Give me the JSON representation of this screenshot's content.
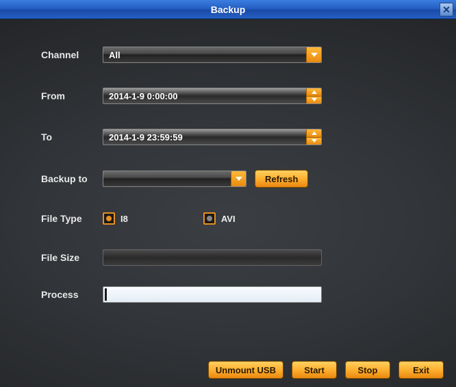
{
  "title": "Backup",
  "labels": {
    "channel": "Channel",
    "from": "From",
    "to": "To",
    "backup_to": "Backup to",
    "file_type": "File Type",
    "file_size": "File Size",
    "process": "Process"
  },
  "fields": {
    "channel_value": "All",
    "from_value": "2014-1-9 0:00:00",
    "to_value": "2014-1-9 23:59:59",
    "backup_to_value": "",
    "file_size_value": ""
  },
  "file_type": {
    "opt1": "I8",
    "opt2": "AVI",
    "selected": "I8"
  },
  "buttons": {
    "refresh": "Refresh",
    "unmount": "Unmount USB",
    "start": "Start",
    "stop": "Stop",
    "exit": "Exit"
  }
}
